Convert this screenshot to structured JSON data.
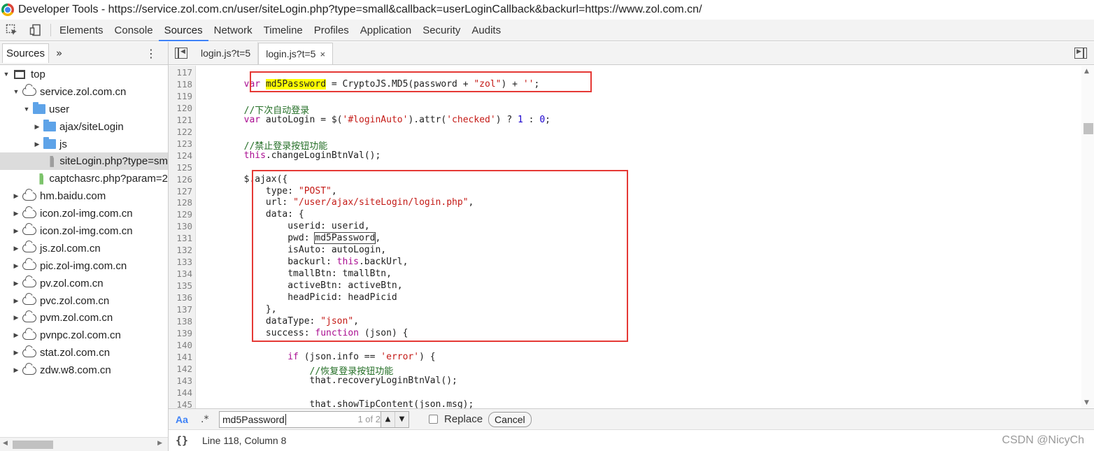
{
  "window": {
    "title": "Developer Tools - https://service.zol.com.cn/user/siteLogin.php?type=small&callback=userLoginCallback&backurl=https://www.zol.com.cn/"
  },
  "main_tabs": [
    "Elements",
    "Console",
    "Sources",
    "Network",
    "Timeline",
    "Profiles",
    "Application",
    "Security",
    "Audits"
  ],
  "active_main_tab": "Sources",
  "sidebar": {
    "tab_label": "Sources",
    "more_label": "»",
    "menu_label": "⋮",
    "tree": [
      {
        "label": "top",
        "icon": "frame-icon",
        "depth": 0,
        "expanded": true
      },
      {
        "label": "service.zol.com.cn",
        "icon": "cloud-icon",
        "depth": 1,
        "expanded": true
      },
      {
        "label": "user",
        "icon": "folder-icon",
        "depth": 2,
        "expanded": true
      },
      {
        "label": "ajax/siteLogin",
        "icon": "folder-icon",
        "depth": 3,
        "expanded": false
      },
      {
        "label": "js",
        "icon": "folder-icon",
        "depth": 3,
        "expanded": false
      },
      {
        "label": "siteLogin.php?type=sm",
        "icon": "file-icon",
        "depth": 4,
        "selected": true
      },
      {
        "label": "captchasrc.php?param=2",
        "icon": "script-file-icon",
        "depth": 3
      },
      {
        "label": "hm.baidu.com",
        "icon": "cloud-icon",
        "depth": 1,
        "expanded": false
      },
      {
        "label": "icon.zol-img.com.cn",
        "icon": "cloud-icon",
        "depth": 1,
        "expanded": false
      },
      {
        "label": "icon.zol-img.com.cn",
        "icon": "cloud-icon",
        "depth": 1,
        "expanded": false
      },
      {
        "label": "js.zol.com.cn",
        "icon": "cloud-icon",
        "depth": 1,
        "expanded": false
      },
      {
        "label": "pic.zol-img.com.cn",
        "icon": "cloud-icon",
        "depth": 1,
        "expanded": false
      },
      {
        "label": "pv.zol.com.cn",
        "icon": "cloud-icon",
        "depth": 1,
        "expanded": false
      },
      {
        "label": "pvc.zol.com.cn",
        "icon": "cloud-icon",
        "depth": 1,
        "expanded": false
      },
      {
        "label": "pvm.zol.com.cn",
        "icon": "cloud-icon",
        "depth": 1,
        "expanded": false
      },
      {
        "label": "pvnpc.zol.com.cn",
        "icon": "cloud-icon",
        "depth": 1,
        "expanded": false
      },
      {
        "label": "stat.zol.com.cn",
        "icon": "cloud-icon",
        "depth": 1,
        "expanded": false
      },
      {
        "label": "zdw.w8.com.cn",
        "icon": "cloud-icon",
        "depth": 1,
        "expanded": false
      }
    ]
  },
  "file_tabs": [
    {
      "label": "login.js?t=5",
      "active": false
    },
    {
      "label": "login.js?t=5",
      "active": true,
      "close": "×"
    }
  ],
  "code": {
    "lines": [
      {
        "n": "117",
        "segs": []
      },
      {
        "n": "118",
        "segs": [
          [
            "        ",
            ""
          ],
          [
            "var",
            "kw"
          ],
          [
            " ",
            ""
          ],
          [
            "md5Password",
            "hl"
          ],
          [
            " = CryptoJS.MD5(password + ",
            ""
          ],
          [
            "\"zol\"",
            "str"
          ],
          [
            ") + ",
            ""
          ],
          [
            "''",
            "str"
          ],
          [
            ";",
            ""
          ]
        ]
      },
      {
        "n": "119",
        "segs": []
      },
      {
        "n": "120",
        "segs": [
          [
            "        ",
            ""
          ],
          [
            "//下次自动登录",
            "cm"
          ]
        ]
      },
      {
        "n": "121",
        "segs": [
          [
            "        ",
            ""
          ],
          [
            "var",
            "kw"
          ],
          [
            " autoLogin = $(",
            ""
          ],
          [
            "'#loginAuto'",
            "str"
          ],
          [
            ").attr(",
            ""
          ],
          [
            "'checked'",
            "str"
          ],
          [
            ") ? ",
            ""
          ],
          [
            "1",
            "num"
          ],
          [
            " : ",
            ""
          ],
          [
            "0",
            "num"
          ],
          [
            ";",
            ""
          ]
        ]
      },
      {
        "n": "122",
        "segs": []
      },
      {
        "n": "123",
        "segs": [
          [
            "        ",
            ""
          ],
          [
            "//禁止登录按钮功能",
            "cm"
          ]
        ]
      },
      {
        "n": "124",
        "segs": [
          [
            "        ",
            ""
          ],
          [
            "this",
            "kw"
          ],
          [
            ".changeLoginBtnVal();",
            ""
          ]
        ]
      },
      {
        "n": "125",
        "segs": []
      },
      {
        "n": "126",
        "segs": [
          [
            "        $.ajax({",
            ""
          ]
        ]
      },
      {
        "n": "127",
        "segs": [
          [
            "            type: ",
            ""
          ],
          [
            "\"POST\"",
            "str"
          ],
          [
            ",",
            ""
          ]
        ]
      },
      {
        "n": "128",
        "segs": [
          [
            "            url: ",
            ""
          ],
          [
            "\"/user/ajax/siteLogin/login.php\"",
            "str"
          ],
          [
            ",",
            ""
          ]
        ]
      },
      {
        "n": "129",
        "segs": [
          [
            "            data: {",
            ""
          ]
        ]
      },
      {
        "n": "130",
        "segs": [
          [
            "                userid: userid,",
            ""
          ]
        ]
      },
      {
        "n": "131",
        "segs": [
          [
            "                pwd: ",
            ""
          ],
          [
            "md5Password",
            "box"
          ],
          [
            ",",
            ""
          ]
        ]
      },
      {
        "n": "132",
        "segs": [
          [
            "                isAuto: autoLogin,",
            ""
          ]
        ]
      },
      {
        "n": "133",
        "segs": [
          [
            "                backurl: ",
            ""
          ],
          [
            "this",
            "kw"
          ],
          [
            ".backUrl,",
            ""
          ]
        ]
      },
      {
        "n": "134",
        "segs": [
          [
            "                tmallBtn: tmallBtn,",
            ""
          ]
        ]
      },
      {
        "n": "135",
        "segs": [
          [
            "                activeBtn: activeBtn,",
            ""
          ]
        ]
      },
      {
        "n": "136",
        "segs": [
          [
            "                headPicid: headPicid",
            ""
          ]
        ]
      },
      {
        "n": "137",
        "segs": [
          [
            "            },",
            ""
          ]
        ]
      },
      {
        "n": "138",
        "segs": [
          [
            "            dataType: ",
            ""
          ],
          [
            "\"json\"",
            "str"
          ],
          [
            ",",
            ""
          ]
        ]
      },
      {
        "n": "139",
        "segs": [
          [
            "            success: ",
            ""
          ],
          [
            "function",
            "kw"
          ],
          [
            " (json) {",
            ""
          ]
        ]
      },
      {
        "n": "140",
        "segs": []
      },
      {
        "n": "141",
        "segs": [
          [
            "                ",
            ""
          ],
          [
            "if",
            "kw"
          ],
          [
            " (json.info == ",
            ""
          ],
          [
            "'error'",
            "str"
          ],
          [
            ") {",
            ""
          ]
        ]
      },
      {
        "n": "142",
        "segs": [
          [
            "                    ",
            ""
          ],
          [
            "//恢复登录按钮功能",
            "cm"
          ]
        ]
      },
      {
        "n": "143",
        "segs": [
          [
            "                    that.recoveryLoginBtnVal();",
            ""
          ]
        ]
      },
      {
        "n": "144",
        "segs": []
      },
      {
        "n": "145",
        "segs": [
          [
            "                    that.showTipContent(json.msg);",
            ""
          ]
        ]
      }
    ]
  },
  "search": {
    "case_label": "Aa",
    "regex_label": ".*",
    "query": "md5Password",
    "match_count": "1 of 2",
    "replace_label": "Replace",
    "cancel_label": "Cancel"
  },
  "status": {
    "format_label": "{}",
    "cursor": "Line 118, Column 8",
    "watermark": "CSDN @NicyCh"
  }
}
